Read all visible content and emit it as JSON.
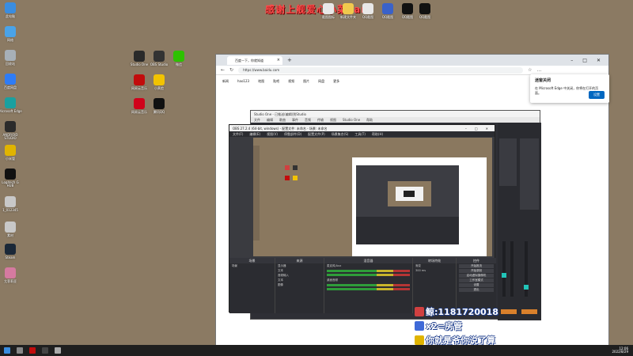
{
  "top_banner": {
    "text": "感谢上舰爱心小菜sam"
  },
  "desktop_icons": [
    {
      "label": "此电脑",
      "color": "#3a8de0"
    },
    {
      "label": "网络",
      "color": "#4aa3e8"
    },
    {
      "label": "回收站",
      "color": "#a7b0b8"
    },
    {
      "label": "百度网盘",
      "color": "#2e7cf6"
    },
    {
      "label": "Microsoft Edge",
      "color": "#1aa0a0"
    },
    {
      "label": "ANDROID STUDIO",
      "color": "#2b2b2b"
    },
    {
      "label": "小米管",
      "color": "#e0b400"
    },
    {
      "label": "Logitech G HUB",
      "color": "#111111"
    },
    {
      "label": "1_012345",
      "color": "#c8c8c8"
    },
    {
      "label": "素材",
      "color": "#c8c8c8"
    },
    {
      "label": "Steam",
      "color": "#1b2838"
    },
    {
      "label": "尤菲莉亚",
      "color": "#d57aa0"
    }
  ],
  "desktop_icons_mid": [
    {
      "label": "Studio One",
      "color": "#2a2a2a"
    },
    {
      "label": "OBS Studio",
      "color": "#333333"
    },
    {
      "label": "微信",
      "color": "#2dc100"
    },
    {
      "label": "网易云音乐",
      "color": "#c20c0c"
    },
    {
      "label": "小黄脸",
      "color": "#f2c300"
    },
    {
      "label": "网易云音乐",
      "color": "#d0021b"
    },
    {
      "label": "腾讯QQ",
      "color": "#111111"
    }
  ],
  "desktop_icons_top": [
    {
      "label": "截图图标",
      "color": "#e8e8e8"
    },
    {
      "label": "新建文件夹",
      "color": "#f0c94d"
    },
    {
      "label": "QQ截图",
      "color": "#e8e8e8"
    },
    {
      "label": "QQ截图",
      "color": "#3a62c9"
    },
    {
      "label": "QQ截图",
      "color": "#111111"
    },
    {
      "label": "QQ截图",
      "color": "#111111"
    }
  ],
  "edge": {
    "tab_title": "百度一下，你就知道",
    "url": "https://www.baidu.com",
    "nav_links": [
      "新闻",
      "hao123",
      "地图",
      "贴吧",
      "视频",
      "图片",
      "网盘",
      "更多"
    ],
    "popup_title": "迷窗关闭",
    "popup_body": "在 Microsoft Edge 中关闭，你将在打开的页面。",
    "popup_button": "设置"
  },
  "studio": {
    "title": "Studio One - 已推送(编辑)到Studio",
    "menu": [
      "文件",
      "编辑",
      "歌曲",
      "事件",
      "音频",
      "传输",
      "视图",
      "Studio One",
      "帮助"
    ]
  },
  "obs": {
    "title": "OBS 27.2.4 (64-bit, windows) - 配置文件: 未命名 - 场景: 未命名",
    "menu": [
      "文件(F)",
      "编辑(E)",
      "视图(V)",
      "停靠部件(D)",
      "配置文件(P)",
      "场景集合(S)",
      "工具(T)",
      "帮助(H)"
    ],
    "docks": {
      "scenes_label": "场景",
      "scenes": [
        "场景"
      ],
      "sources_label": "来源",
      "sources": [
        "显示器",
        "文本",
        "音频输入",
        "文本",
        "图像"
      ],
      "mixer_label": "混音器",
      "mixer_tracks": [
        "麦克风/Aux",
        "桌面音频"
      ],
      "transitions_label": "转场特效",
      "transition_value": "渐变",
      "duration_value": "300 ms",
      "controls_label": "控件",
      "controls": [
        "开始推流",
        "开始录制",
        "启动虚拟摄像机",
        "工作室模式",
        "设置",
        "退出"
      ]
    }
  },
  "chat": [
    {
      "text": "鲸:1181720018",
      "avatar_color": "#d04040"
    },
    {
      "text": "x2=房管",
      "avatar_color": "#3f6ad8"
    },
    {
      "text": "你就是爷你说了算",
      "avatar_color": "#e0b400"
    }
  ],
  "taskbar": {
    "time": "12:06",
    "date": "2022/8/29"
  }
}
